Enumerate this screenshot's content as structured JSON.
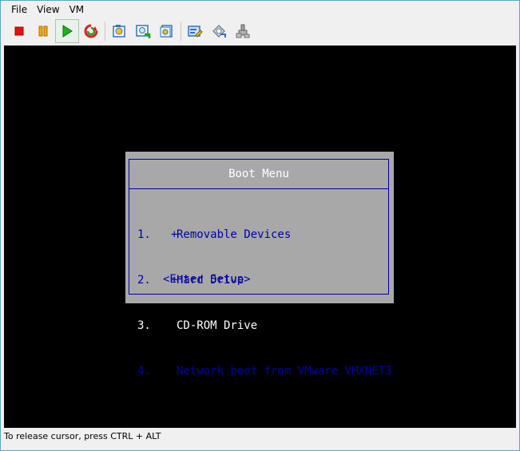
{
  "menu": [
    "File",
    "View",
    "VM"
  ],
  "toolbar": {
    "buttons": [
      {
        "name": "power-off-button",
        "icon": "stop-icon",
        "color": "#e81010"
      },
      {
        "name": "suspend-button",
        "icon": "pause-icon",
        "color": "#e8a000"
      },
      {
        "name": "power-on-button",
        "icon": "play-icon",
        "color": "#10a010"
      },
      {
        "name": "reset-button",
        "icon": "reset-icon",
        "color": "#e02020"
      },
      {
        "name": "snapshot-button",
        "icon": "snapshot-icon"
      },
      {
        "name": "revert-snapshot-button",
        "icon": "revert-snapshot-icon"
      },
      {
        "name": "manage-snapshots-button",
        "icon": "manage-snapshots-icon"
      },
      {
        "name": "edit-settings-button",
        "icon": "edit-settings-icon"
      },
      {
        "name": "cd-dvd-button",
        "icon": "cd-dvd-icon"
      },
      {
        "name": "devices-button",
        "icon": "devices-icon"
      }
    ]
  },
  "boot_menu": {
    "title": "Boot Menu",
    "items": [
      {
        "num": "1.",
        "mark": "+",
        "label": "Removable Devices",
        "style": "normal"
      },
      {
        "num": "2.",
        "mark": "+",
        "label": "Hard Drive",
        "style": "normal"
      },
      {
        "num": "3.",
        "mark": " ",
        "label": "CD-ROM Drive",
        "style": "dim"
      },
      {
        "num": "4.",
        "mark": " ",
        "label": "Network boot from VMware VMXNET3",
        "style": "normal"
      }
    ],
    "setup": "<Enter Setup>"
  },
  "status": "To release cursor, press CTRL + ALT",
  "colors": {
    "bios_blue": "#0000a8",
    "bios_gray": "#a8a8a8",
    "console_bg": "#000000",
    "chrome_bg": "#f0f0f0"
  }
}
